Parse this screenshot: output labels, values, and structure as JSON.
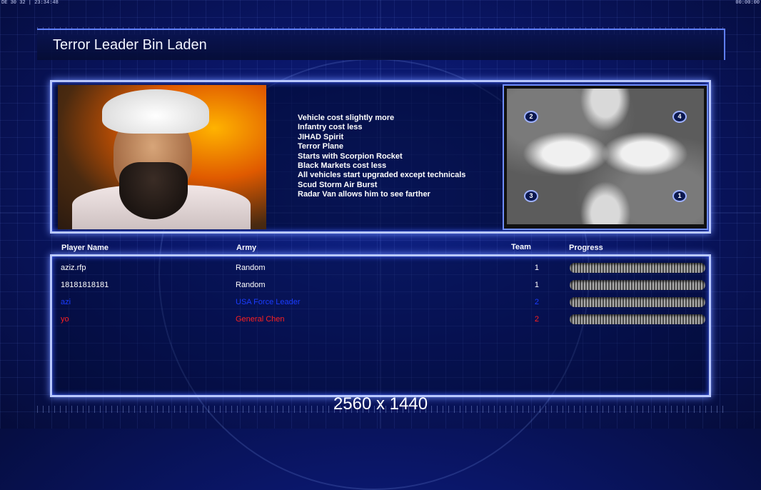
{
  "status_bar": {
    "left": "DE 30 32 | 23:34:48",
    "right": "00:00:00"
  },
  "title": "Terror Leader Bin Laden",
  "features": [
    "Vehicle cost slightly more",
    "Infantry cost less",
    "JIHAD Spirit",
    "Terror Plane",
    "Starts with Scorpion Rocket",
    "Black Markets cost less",
    "All vehicles start upgraded except technicals",
    "Scud Storm Air Burst",
    "Radar Van allows him to see farther"
  ],
  "minimap": {
    "spawns": [
      "2",
      "4",
      "3",
      "1"
    ]
  },
  "columns": {
    "player": "Player Name",
    "army": "Army",
    "team": "Team",
    "progress": "Progress"
  },
  "players": [
    {
      "name": "aziz.rfp",
      "army": "Random",
      "team": "1",
      "color": "#ffffff",
      "progress": 0
    },
    {
      "name": "18181818181",
      "army": "Random",
      "team": "1",
      "color": "#ffffff",
      "progress": 0
    },
    {
      "name": "azi",
      "army": "USA Force Leader",
      "team": "2",
      "color": "#1a3cff",
      "progress": 0
    },
    {
      "name": "yo",
      "army": "General Chen",
      "team": "2",
      "color": "#ff2020",
      "progress": 0
    }
  ],
  "resolution": "2560 x 1440"
}
